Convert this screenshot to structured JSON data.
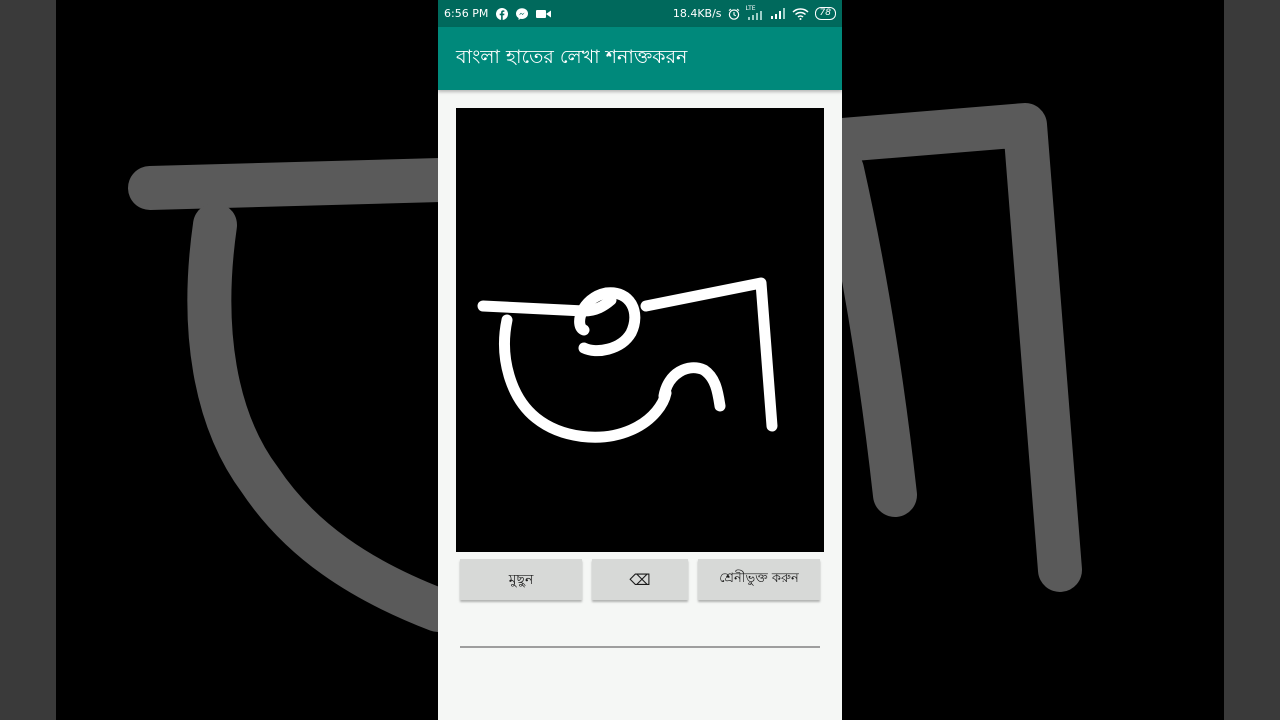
{
  "status_bar": {
    "time": "6:56 PM",
    "left_icons": [
      "facebook-icon",
      "messenger-icon",
      "video-icon"
    ],
    "speed": "18.4KB/s",
    "right_icons": [
      "alarm-icon",
      "lte-signal-icon",
      "signal-icon",
      "wifi-icon"
    ],
    "lte_label": "LTE",
    "battery": "78"
  },
  "app_bar": {
    "title": "বাংলা হাতের লেখা শনাক্তকরন"
  },
  "buttons": {
    "clear_label": "মুছুন",
    "backspace_label": "⌫",
    "classify_label": "শ্রেনীভুক্ত করুন"
  },
  "result": {
    "value": ""
  },
  "colors": {
    "status_bar": "#00695c",
    "app_bar": "#00897b",
    "canvas": "#000000",
    "stroke": "#ffffff",
    "button": "#d7d9d7"
  }
}
